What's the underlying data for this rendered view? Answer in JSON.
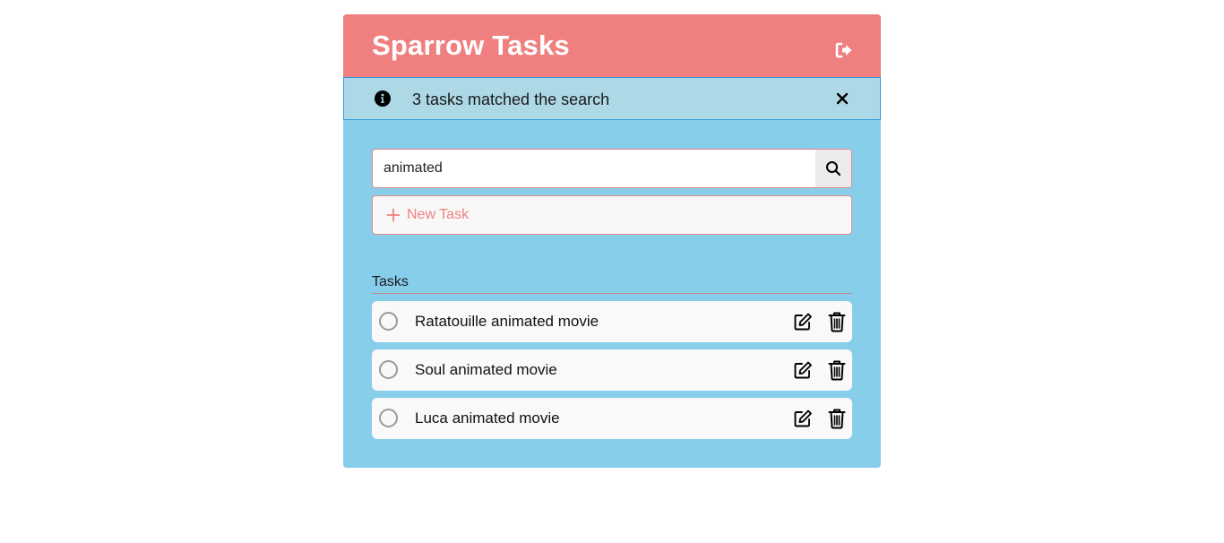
{
  "app": {
    "title": "Sparrow Tasks",
    "colors": {
      "header": "#f08080",
      "body": "#87ceeb",
      "alert": "#add8e6",
      "accent": "#f08080"
    },
    "logout_icon": "sign-out-icon"
  },
  "alert": {
    "icon": "info-circle-icon",
    "message": "3 tasks matched the search",
    "close_icon": "close-icon"
  },
  "search": {
    "value": "animated",
    "button_icon": "search-icon"
  },
  "new_task": {
    "icon": "plus-icon",
    "label": "New Task"
  },
  "tasks": {
    "heading": "Tasks",
    "items": [
      {
        "label": "Ratatouille animated movie",
        "completed": false
      },
      {
        "label": "Soul animated movie",
        "completed": false
      },
      {
        "label": "Luca animated movie",
        "completed": false
      }
    ],
    "edit_icon": "edit-icon",
    "delete_icon": "trash-icon"
  }
}
